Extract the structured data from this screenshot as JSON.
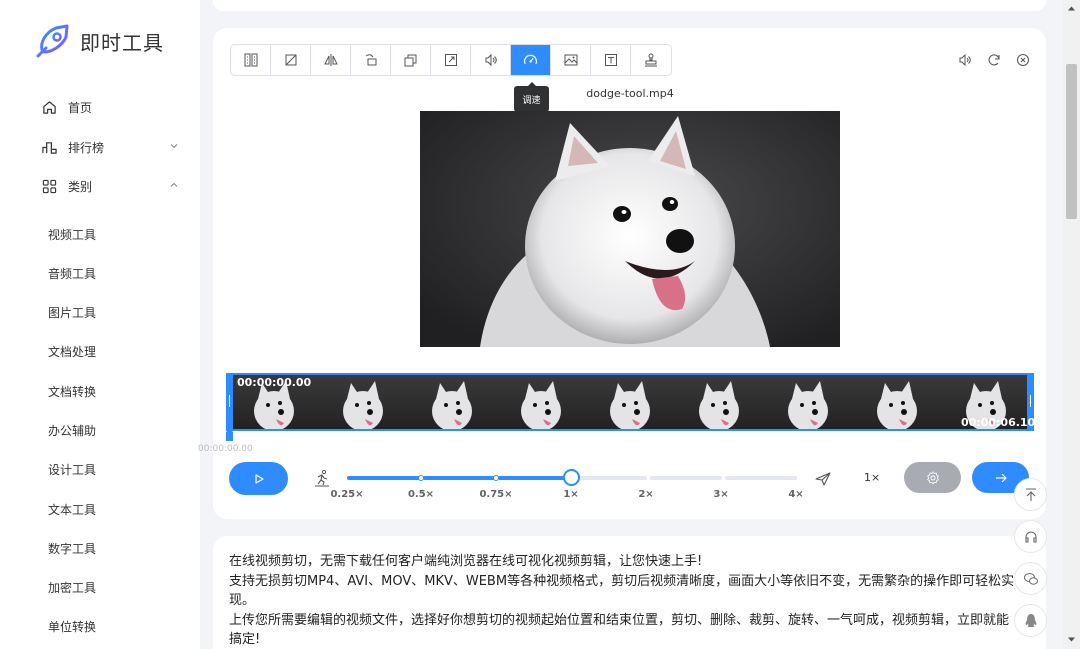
{
  "app": {
    "title": "即时工具"
  },
  "sidebar": {
    "nav": [
      {
        "label": "首页",
        "icon": "home-icon"
      },
      {
        "label": "排行榜",
        "icon": "ranking-icon",
        "expanded": false
      },
      {
        "label": "类别",
        "icon": "category-icon",
        "expanded": true
      }
    ],
    "categories": [
      "视频工具",
      "音频工具",
      "图片工具",
      "文档处理",
      "文档转换",
      "办公辅助",
      "设计工具",
      "文本工具",
      "数字工具",
      "加密工具",
      "单位转换"
    ]
  },
  "editor": {
    "toolbar": [
      {
        "name": "split-tool",
        "icon": "split-icon",
        "active": false
      },
      {
        "name": "crop-tool",
        "icon": "crop-icon",
        "active": false
      },
      {
        "name": "flip-tool",
        "icon": "flip-icon",
        "active": false
      },
      {
        "name": "rotate-tool",
        "icon": "rotate-icon",
        "active": false
      },
      {
        "name": "resize-tool",
        "icon": "resize-icon",
        "active": false
      },
      {
        "name": "export-tool",
        "icon": "export-icon",
        "active": false
      },
      {
        "name": "volume-tool",
        "icon": "volume-icon",
        "active": false
      },
      {
        "name": "speed-tool",
        "icon": "speed-icon",
        "active": true
      },
      {
        "name": "image-tool",
        "icon": "image-icon",
        "active": false
      },
      {
        "name": "text-tool",
        "icon": "text-icon",
        "active": false
      },
      {
        "name": "stamp-tool",
        "icon": "stamp-icon",
        "active": false
      }
    ],
    "tooltip": "调速",
    "filename": "dodge-tool.mp4",
    "timeline": {
      "start_time": "00:00:00.00",
      "end_time": "00:00:06.10",
      "playhead_time": "00:00:00.00",
      "frame_count": 9
    },
    "speed": {
      "options": [
        "0.25×",
        "0.5×",
        "0.75×",
        "1×",
        "2×",
        "3×",
        "4×"
      ],
      "current": "1×",
      "selected_index": 3
    }
  },
  "description": {
    "lines": [
      "在线视频剪切，无需下载任何客户端纯浏览器在线可视化视频剪辑，让您快速上手!",
      "支持无损剪切MP4、AVI、MOV、MKV、WEBM等各种视频格式，剪切后视频清晰度，画面大小等依旧不变，无需繁杂的操作即可轻松实现。",
      "上传您所需要编辑的视频文件，选择好你想剪切的视频起始位置和结束位置，剪切、删除、裁剪、旋转、一气呵成，视频剪辑，立即就能搞定!"
    ]
  },
  "colors": {
    "accent": "#2f8cff",
    "grey_button": "#a8abb2",
    "background": "#f3f4f7"
  }
}
